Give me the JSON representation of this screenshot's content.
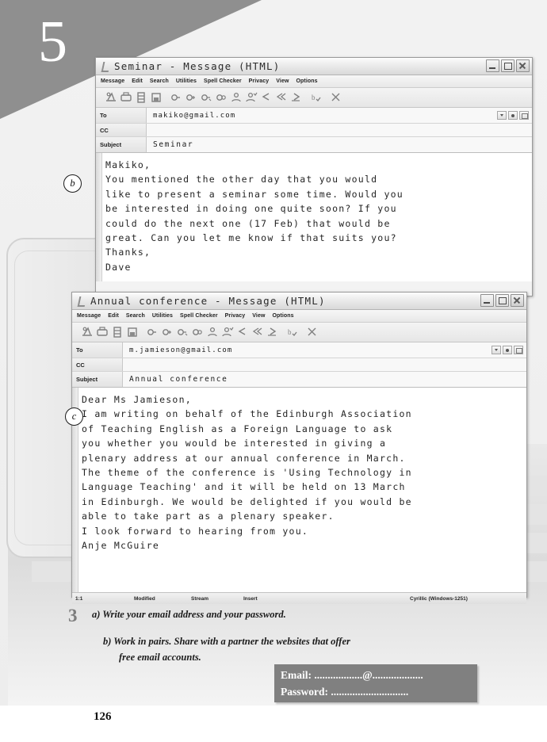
{
  "page": {
    "unit_number": "5",
    "page_number": "126"
  },
  "markers": {
    "b": "b",
    "c": "c"
  },
  "window_common": {
    "menu": [
      "Message",
      "Edit",
      "Search",
      "Utilities",
      "Spell Checker",
      "Privacy",
      "View",
      "Options"
    ],
    "toolbar_icons": [
      "send-icon",
      "print-icon",
      "attach-icon",
      "save-icon",
      "link-icon-1",
      "link-icon-2",
      "link-icon-3",
      "link-icon-4",
      "contact-icon",
      "contact-check-icon",
      "reply-icon",
      "reply-all-icon",
      "forward-icon",
      "spell-check-icon",
      "close-x-icon"
    ],
    "field_labels": {
      "to": "To",
      "cc": "CC",
      "subject": "Subject"
    },
    "field_buttons": [
      "dropdown-caret-icon",
      "select-recipient-icon",
      "address-book-icon"
    ],
    "window_buttons": [
      "minimize-icon",
      "maximize-icon",
      "close-icon"
    ]
  },
  "windows": [
    {
      "id": "seminar",
      "title": "Seminar - Message (HTML)",
      "to": "makiko@gmail.com",
      "cc": "",
      "subject": "Seminar",
      "body_lines": [
        "Makiko,",
        "You mentioned the other day that you would",
        "like to present a seminar some time. Would you",
        "be interested in doing one quite soon? If you",
        "could do the next one (17 Feb) that would be",
        "great. Can you let me know if that suits you?",
        "Thanks,",
        "Dave"
      ]
    },
    {
      "id": "conference",
      "title": "Annual conference - Message (HTML)",
      "to": "m.jamieson@gmail.com",
      "cc": "",
      "subject": "Annual conference",
      "body_lines": [
        "Dear Ms Jamieson,",
        "I am writing on behalf of the Edinburgh Association",
        "of Teaching English as a Foreign Language to ask",
        "you whether you would be interested in giving a",
        "plenary address at our annual conference in March.",
        "The theme of the conference is 'Using Technology in",
        "Language Teaching' and it will be held on 13 March",
        "in Edinburgh. We would be delighted if you would be",
        "able to take part as a plenary speaker.",
        "I look forward to hearing from you.",
        "Anje McGuire"
      ],
      "status_bar": {
        "position": "1:1",
        "modified": "Modified",
        "mode": "Stream",
        "insert": "Insert",
        "extra": "",
        "encoding": "Cyrillic (Windows-1251)"
      }
    }
  ],
  "exercise": {
    "number": "3",
    "item_a": "a) Write your email address and your password.",
    "item_b_line1": "b) Work in pairs. Share with a partner the websites that offer",
    "item_b_line2": "free email accounts."
  },
  "answer_box": {
    "email_label": "Email: ..................@...................",
    "password_label": "Password: ............................."
  },
  "colors": {
    "banner": "#8f8f8f",
    "answer_box": "#808080",
    "window_border": "#9a9a9a"
  }
}
